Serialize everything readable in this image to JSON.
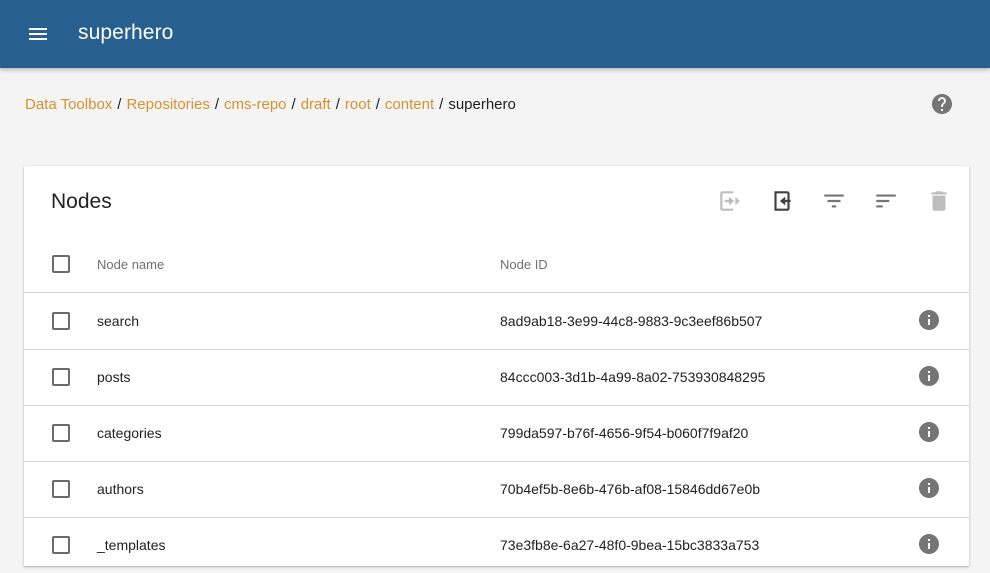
{
  "app": {
    "title": "superhero",
    "menu_icon": "menu-icon"
  },
  "breadcrumb": {
    "links": [
      "Data Toolbox",
      "Repositories",
      "cms-repo",
      "draft",
      "root",
      "content"
    ],
    "current": "superhero",
    "separator": "/"
  },
  "help_icon": "help-icon",
  "card": {
    "title": "Nodes",
    "toolbar_icons": [
      "import-icon",
      "export-icon",
      "filter-icon",
      "sort-icon",
      "delete-icon"
    ]
  },
  "table": {
    "columns": [
      "Node name",
      "Node ID"
    ],
    "rows": [
      {
        "name": "search",
        "id": "8ad9ab18-3e99-44c8-9883-9c3eef86b507"
      },
      {
        "name": "posts",
        "id": "84ccc003-3d1b-4a99-8a02-753930848295"
      },
      {
        "name": "categories",
        "id": "799da597-b76f-4656-9f54-b060f7f9af20"
      },
      {
        "name": "authors",
        "id": "70b4ef5b-8e6b-476b-af08-15846dd67e0b"
      },
      {
        "name": "_templates",
        "id": "73e3fb8e-6a27-48f0-9bea-15bc3833a753"
      }
    ]
  },
  "colors": {
    "appbar": "#275f8e",
    "link": "#d4912f",
    "icon_gray": "#757575",
    "icon_disabled": "#bdbdbd"
  }
}
